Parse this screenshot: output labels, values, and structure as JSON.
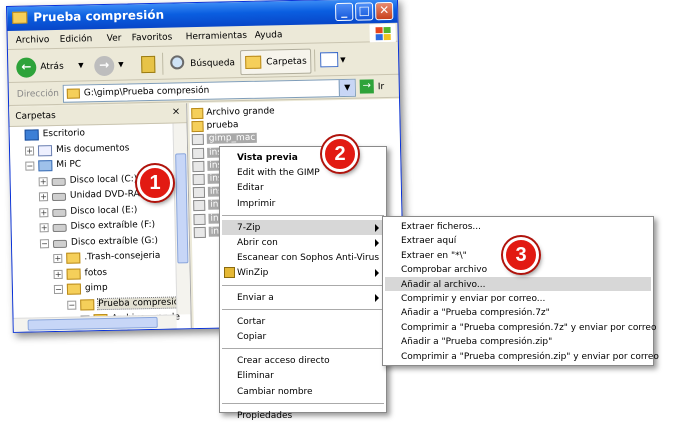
{
  "window": {
    "title": "Prueba compresión",
    "controls": {
      "minimize": "_",
      "maximize": "□",
      "close": "✕"
    }
  },
  "menubar": [
    "Archivo",
    "Edición",
    "Ver",
    "Favoritos",
    "Herramientas",
    "Ayuda"
  ],
  "toolbar": {
    "back": "Atrás",
    "search": "Búsqueda",
    "folders": "Carpetas",
    "back_icon": "left-arrow-icon",
    "forward_icon": "right-arrow-icon"
  },
  "address": {
    "label": "Dirección",
    "value": "G:\\gimp\\Prueba compresión",
    "go": "Ir"
  },
  "tree": {
    "header": "Carpetas",
    "close": "×",
    "items": [
      {
        "label": "Escritorio",
        "icon": "desk",
        "level": 0,
        "exp": ""
      },
      {
        "label": "Mis documentos",
        "icon": "docs",
        "level": 1,
        "exp": "+"
      },
      {
        "label": "Mi PC",
        "icon": "computer",
        "level": 1,
        "exp": "−"
      },
      {
        "label": "Disco local (C:)",
        "icon": "drive",
        "level": 2,
        "exp": "+"
      },
      {
        "label": "Unidad DVD-RAM (D:)",
        "icon": "drive",
        "level": 2,
        "exp": "+"
      },
      {
        "label": "Disco local (E:)",
        "icon": "drive",
        "level": 2,
        "exp": "+"
      },
      {
        "label": "Disco extraíble (F:)",
        "icon": "drive",
        "level": 2,
        "exp": "+"
      },
      {
        "label": "Disco extraíble (G:)",
        "icon": "drive",
        "level": 2,
        "exp": "−"
      },
      {
        "label": ".Trash-consejeria",
        "icon": "folder",
        "level": 3,
        "exp": "+"
      },
      {
        "label": "fotos",
        "icon": "folder",
        "level": 3,
        "exp": "+"
      },
      {
        "label": "gimp",
        "icon": "folder",
        "level": 3,
        "exp": "−"
      },
      {
        "label": "Prueba compresión",
        "icon": "folder",
        "level": 4,
        "exp": "−"
      },
      {
        "label": "Archivo grande",
        "icon": "folder",
        "level": 5,
        "exp": "+"
      }
    ]
  },
  "files": [
    {
      "label": "Archivo grande",
      "icon": "folder",
      "selected": false
    },
    {
      "label": "prueba",
      "icon": "folder",
      "selected": false
    },
    {
      "label": "gimp_mac",
      "icon": "doc",
      "selected": true
    },
    {
      "label": "inst",
      "icon": "doc",
      "selected": true
    },
    {
      "label": "inst",
      "icon": "doc",
      "selected": true
    },
    {
      "label": "inst",
      "icon": "doc",
      "selected": true
    },
    {
      "label": "inst",
      "icon": "doc",
      "selected": true
    },
    {
      "label": "inst",
      "icon": "doc",
      "selected": true
    },
    {
      "label": "inst",
      "icon": "doc",
      "selected": true
    },
    {
      "label": "inst",
      "icon": "doc",
      "selected": true
    }
  ],
  "context_menu": {
    "items": [
      {
        "label": "Vista previa",
        "bold": true
      },
      {
        "label": "Edit with the GIMP"
      },
      {
        "label": "Editar"
      },
      {
        "label": "Imprimir"
      },
      {
        "sep": true
      },
      {
        "label": "7-Zip",
        "submenu": true,
        "highlight": true
      },
      {
        "label": "Abrir con",
        "submenu": true
      },
      {
        "label": "Escanear con Sophos Anti-Virus"
      },
      {
        "label": "WinZip",
        "submenu": true,
        "icon": "winzip-icon"
      },
      {
        "sep": true
      },
      {
        "label": "Enviar a",
        "submenu": true
      },
      {
        "sep": true
      },
      {
        "label": "Cortar"
      },
      {
        "label": "Copiar"
      },
      {
        "sep": true
      },
      {
        "label": "Crear acceso directo"
      },
      {
        "label": "Eliminar"
      },
      {
        "label": "Cambiar nombre"
      },
      {
        "sep": true
      },
      {
        "label": "Propiedades"
      }
    ]
  },
  "submenu_7zip": {
    "items": [
      {
        "label": "Extraer ficheros..."
      },
      {
        "label": "Extraer aquí"
      },
      {
        "label": "Extraer en \"*\\\""
      },
      {
        "label": "Comprobar archivo"
      },
      {
        "label": "Añadir al archivo...",
        "highlight": true
      },
      {
        "label": "Comprimir y enviar por correo..."
      },
      {
        "label": "Añadir a \"Prueba compresión.7z\""
      },
      {
        "label": "Comprimir a \"Prueba compresión.7z\" y enviar por correo"
      },
      {
        "label": "Añadir a \"Prueba compresión.zip\""
      },
      {
        "label": "Comprimir a \"Prueba compresión.zip\" y enviar por correo"
      }
    ]
  },
  "badges": [
    "1",
    "2",
    "3"
  ]
}
